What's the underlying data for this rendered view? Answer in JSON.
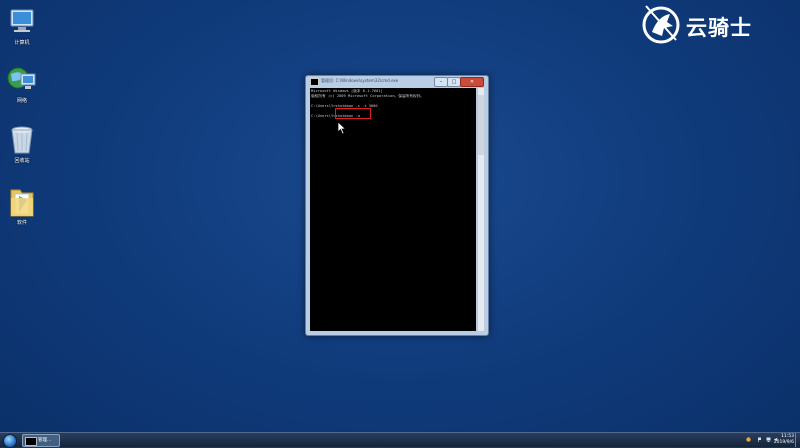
{
  "desktop": {
    "icons": [
      {
        "label": "计算机",
        "icon": "computer-icon"
      },
      {
        "label": "网络",
        "icon": "network-icon"
      },
      {
        "label": "回收站",
        "icon": "recycle-bin-icon"
      },
      {
        "label": "软件",
        "icon": "folder-icon"
      }
    ]
  },
  "logo": {
    "text": "云骑士"
  },
  "window": {
    "title": "管理员: C:\\Windows\\system32\\cmd.exe",
    "min_label": "–",
    "max_label": "□",
    "close_label": "✕"
  },
  "console": {
    "lines": [
      "Microsoft Windows [版本 6.1.7601]",
      "版权所有 (c) 2009 Microsoft Corporation。保留所有权利。",
      "",
      "C:\\Users\\Y>shutdown -s -t 3600",
      "",
      "C:\\Users\\Y>shutdown -a"
    ]
  },
  "taskbar": {
    "task_label": "管理...",
    "clock_time": "11:53",
    "clock_date": "2019/9/6"
  },
  "colors": {
    "desktop": "#0f3a7a",
    "console_bg": "#000000",
    "highlight": "#e02020"
  }
}
